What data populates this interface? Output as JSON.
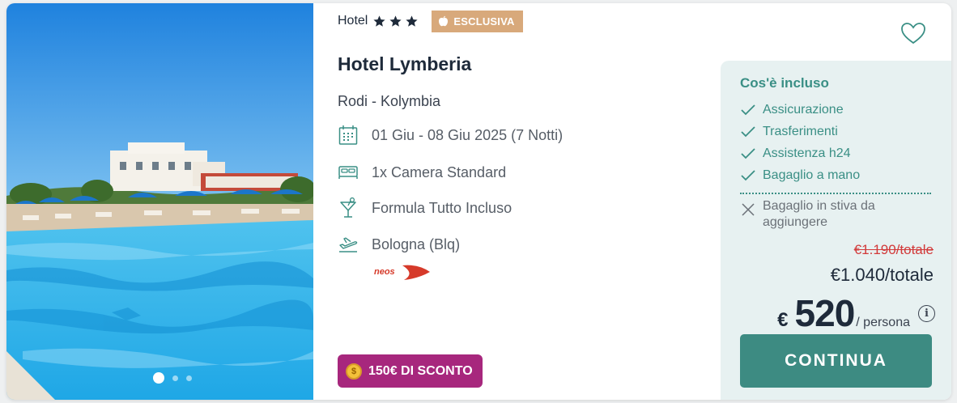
{
  "hotel": {
    "category_label": "Hotel",
    "stars": 3,
    "exclusive_badge": "ESCLUSIVA",
    "name": "Hotel Lymberia",
    "location": "Rodi - Kolymbia",
    "dates": "01 Giu - 08 Giu 2025 (7 Notti)",
    "room": "1x Camera Standard",
    "board": "Formula Tutto Incluso",
    "departure": "Bologna (Blq)",
    "airline_logo_text": "neos",
    "discount_label": "150€ DI SCONTO",
    "discount_icon": "coin-icon"
  },
  "gallery": {
    "total_images": 3,
    "active_index": 0
  },
  "included": {
    "title": "Cos'è incluso",
    "items": [
      "Assicurazione",
      "Trasferimenti",
      "Assistenza h24",
      "Bagaglio a mano"
    ],
    "excluded": [
      "Bagaglio in stiva da aggiungere"
    ]
  },
  "pricing": {
    "old_total": "€1.190/totale",
    "total": "€1.040/totale",
    "currency": "€",
    "per_person_value": "520",
    "per_person_unit": "/ persona",
    "info_icon": "info-icon"
  },
  "actions": {
    "continue_label": "CONTINUA",
    "favorite_icon": "heart-icon"
  },
  "colors": {
    "accent_teal": "#3d8b82",
    "badge_gold": "#d8a97b",
    "discount_magenta": "#a7277d",
    "old_price_red": "#d23a3a",
    "panel_bg": "#e7f1f1"
  }
}
